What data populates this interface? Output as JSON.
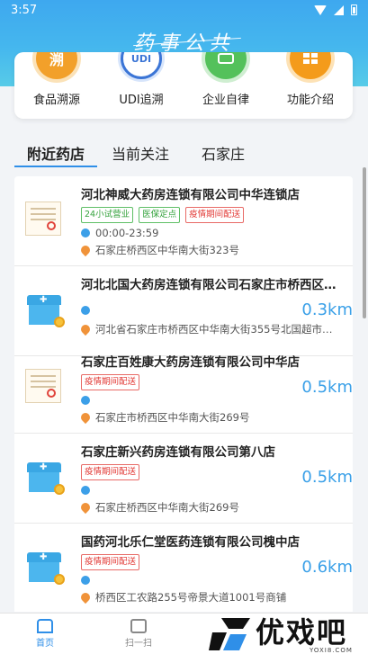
{
  "status_bar": {
    "time": "3:57"
  },
  "header": {
    "logo_text": "药事公共"
  },
  "functions": [
    {
      "label": "食品溯源",
      "icon": "food-trace-icon",
      "glyph": "溯",
      "color": "#f2a02a"
    },
    {
      "label": "UDI追溯",
      "icon": "udi-trace-icon",
      "glyph": "UDI",
      "color": "#3b75d6"
    },
    {
      "label": "企业自律",
      "icon": "enterprise-icon",
      "glyph": "",
      "color": "#54c15b"
    },
    {
      "label": "功能介绍",
      "icon": "feature-intro-icon",
      "glyph": "",
      "color": "#f49b1b"
    }
  ],
  "tabs": [
    {
      "label": "附近药店",
      "active": true
    },
    {
      "label": "当前关注",
      "active": false
    },
    {
      "label": "石家庄",
      "active": false
    }
  ],
  "pharmacies": [
    {
      "name": "河北神威大药房连锁有限公司中华连锁店",
      "thumb": "certificate",
      "tags": [
        {
          "text": "24小试营业",
          "color": "green"
        },
        {
          "text": "医保定点",
          "color": "green"
        },
        {
          "text": "疫情期间配送",
          "color": "red"
        }
      ],
      "hours": "00:00-23:59",
      "address": "石家庄桥西区中华南大街323号",
      "distance": ""
    },
    {
      "name": "河北北国大药房连锁有限公司石家庄市桥西区…",
      "thumb": "store",
      "tags": [],
      "hours": "",
      "address": "河北省石家庄市桥西区中华南大街355号北国超市…",
      "distance": "0.3km"
    },
    {
      "name": "石家庄百姓康大药房连锁有限公司中华店",
      "thumb": "certificate",
      "tags": [
        {
          "text": "疫情期间配送",
          "color": "red"
        }
      ],
      "hours": "",
      "address": "石家庄市桥西区中华南大街269号",
      "distance": "0.5km"
    },
    {
      "name": "石家庄新兴药房连锁有限公司第八店",
      "thumb": "store",
      "tags": [
        {
          "text": "疫情期间配送",
          "color": "red"
        }
      ],
      "hours": "",
      "address": "石家庄桥西区中华南大街269号",
      "distance": "0.5km"
    },
    {
      "name": "国药河北乐仁堂医药连锁有限公司槐中店",
      "thumb": "store",
      "tags": [
        {
          "text": "疫情期间配送",
          "color": "red"
        }
      ],
      "hours": "",
      "address": "桥西区工农路255号帝景大道1001号商铺",
      "distance": "0.6km"
    }
  ],
  "tab_bar": [
    {
      "label": "首页",
      "active": true
    },
    {
      "label": "扫一扫",
      "active": false
    }
  ],
  "watermark": {
    "text": "优戏吧",
    "url": "YOXI8.COM"
  },
  "colors": {
    "accent": "#2f8fe8",
    "header": "#45b7ee",
    "tag_green": "#35a23d",
    "tag_red": "#e23a36"
  }
}
